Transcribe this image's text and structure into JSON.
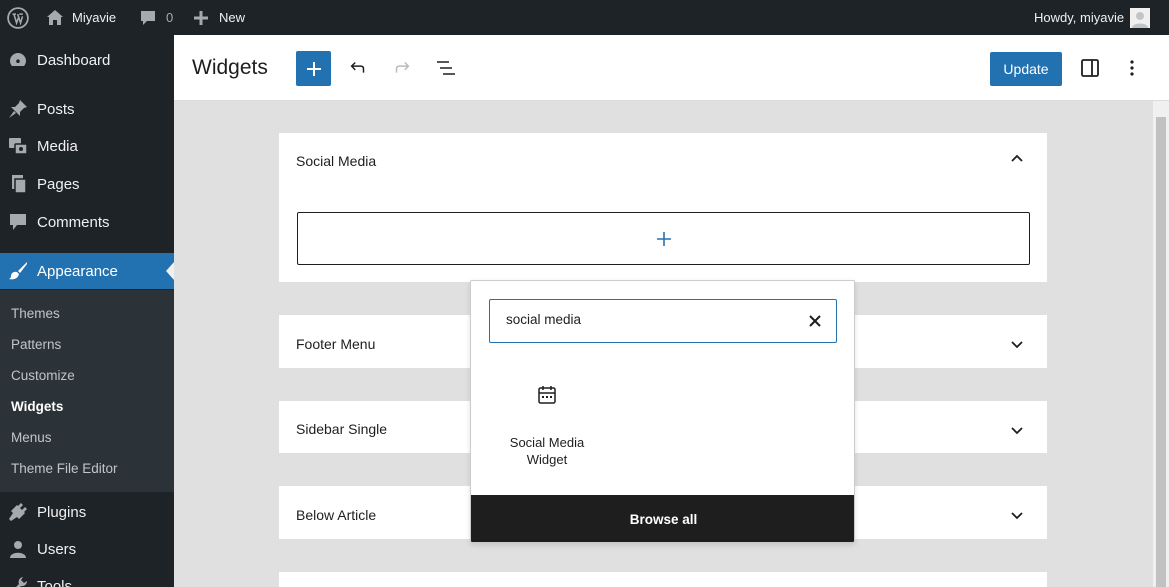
{
  "adminbar": {
    "site_name": "Miyavie",
    "comments_count": "0",
    "new_label": "New",
    "howdy": "Howdy, miyavie"
  },
  "sidebar": {
    "items": [
      {
        "label": "Dashboard",
        "icon": "dashboard-icon"
      },
      {
        "label": "Posts",
        "icon": "pin-icon"
      },
      {
        "label": "Media",
        "icon": "media-icon"
      },
      {
        "label": "Pages",
        "icon": "pages-icon"
      },
      {
        "label": "Comments",
        "icon": "comment-icon"
      },
      {
        "label": "Appearance",
        "icon": "paintbrush-icon",
        "current": true
      },
      {
        "label": "Plugins",
        "icon": "plugin-icon"
      },
      {
        "label": "Users",
        "icon": "users-icon"
      },
      {
        "label": "Tools",
        "icon": "tools-icon"
      }
    ],
    "submenu": [
      "Themes",
      "Patterns",
      "Customize",
      "Widgets",
      "Menus",
      "Theme File Editor"
    ],
    "submenu_current": "Widgets"
  },
  "header": {
    "title": "Widgets",
    "update_label": "Update"
  },
  "widget_areas": [
    {
      "title": "Social Media",
      "expanded": true
    },
    {
      "title": "Footer Menu",
      "expanded": false
    },
    {
      "title": "Sidebar Single",
      "expanded": false
    },
    {
      "title": "Below Article",
      "expanded": false
    }
  ],
  "inserter": {
    "search_value": "social media",
    "result_label": "Social Media Widget",
    "result_icon": "calendar-icon",
    "browse_all_label": "Browse all"
  },
  "colors": {
    "admin_dark": "#1d2327",
    "accent": "#2271b1",
    "canvas": "#e0e0e0"
  }
}
